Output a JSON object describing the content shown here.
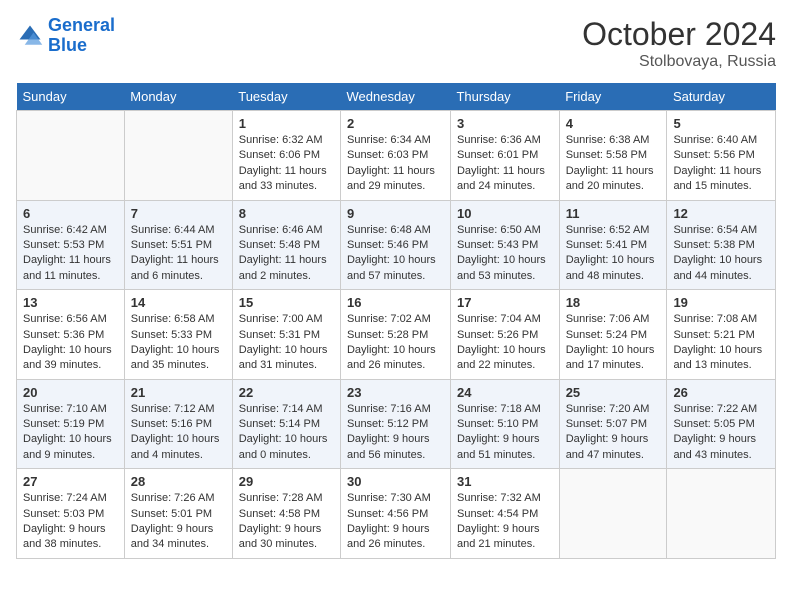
{
  "header": {
    "logo_line1": "General",
    "logo_line2": "Blue",
    "month": "October 2024",
    "location": "Stolbovaya, Russia"
  },
  "days_of_week": [
    "Sunday",
    "Monday",
    "Tuesday",
    "Wednesday",
    "Thursday",
    "Friday",
    "Saturday"
  ],
  "weeks": [
    [
      {
        "day": "",
        "info": ""
      },
      {
        "day": "",
        "info": ""
      },
      {
        "day": "1",
        "info": "Sunrise: 6:32 AM\nSunset: 6:06 PM\nDaylight: 11 hours and 33 minutes."
      },
      {
        "day": "2",
        "info": "Sunrise: 6:34 AM\nSunset: 6:03 PM\nDaylight: 11 hours and 29 minutes."
      },
      {
        "day": "3",
        "info": "Sunrise: 6:36 AM\nSunset: 6:01 PM\nDaylight: 11 hours and 24 minutes."
      },
      {
        "day": "4",
        "info": "Sunrise: 6:38 AM\nSunset: 5:58 PM\nDaylight: 11 hours and 20 minutes."
      },
      {
        "day": "5",
        "info": "Sunrise: 6:40 AM\nSunset: 5:56 PM\nDaylight: 11 hours and 15 minutes."
      }
    ],
    [
      {
        "day": "6",
        "info": "Sunrise: 6:42 AM\nSunset: 5:53 PM\nDaylight: 11 hours and 11 minutes."
      },
      {
        "day": "7",
        "info": "Sunrise: 6:44 AM\nSunset: 5:51 PM\nDaylight: 11 hours and 6 minutes."
      },
      {
        "day": "8",
        "info": "Sunrise: 6:46 AM\nSunset: 5:48 PM\nDaylight: 11 hours and 2 minutes."
      },
      {
        "day": "9",
        "info": "Sunrise: 6:48 AM\nSunset: 5:46 PM\nDaylight: 10 hours and 57 minutes."
      },
      {
        "day": "10",
        "info": "Sunrise: 6:50 AM\nSunset: 5:43 PM\nDaylight: 10 hours and 53 minutes."
      },
      {
        "day": "11",
        "info": "Sunrise: 6:52 AM\nSunset: 5:41 PM\nDaylight: 10 hours and 48 minutes."
      },
      {
        "day": "12",
        "info": "Sunrise: 6:54 AM\nSunset: 5:38 PM\nDaylight: 10 hours and 44 minutes."
      }
    ],
    [
      {
        "day": "13",
        "info": "Sunrise: 6:56 AM\nSunset: 5:36 PM\nDaylight: 10 hours and 39 minutes."
      },
      {
        "day": "14",
        "info": "Sunrise: 6:58 AM\nSunset: 5:33 PM\nDaylight: 10 hours and 35 minutes."
      },
      {
        "day": "15",
        "info": "Sunrise: 7:00 AM\nSunset: 5:31 PM\nDaylight: 10 hours and 31 minutes."
      },
      {
        "day": "16",
        "info": "Sunrise: 7:02 AM\nSunset: 5:28 PM\nDaylight: 10 hours and 26 minutes."
      },
      {
        "day": "17",
        "info": "Sunrise: 7:04 AM\nSunset: 5:26 PM\nDaylight: 10 hours and 22 minutes."
      },
      {
        "day": "18",
        "info": "Sunrise: 7:06 AM\nSunset: 5:24 PM\nDaylight: 10 hours and 17 minutes."
      },
      {
        "day": "19",
        "info": "Sunrise: 7:08 AM\nSunset: 5:21 PM\nDaylight: 10 hours and 13 minutes."
      }
    ],
    [
      {
        "day": "20",
        "info": "Sunrise: 7:10 AM\nSunset: 5:19 PM\nDaylight: 10 hours and 9 minutes."
      },
      {
        "day": "21",
        "info": "Sunrise: 7:12 AM\nSunset: 5:16 PM\nDaylight: 10 hours and 4 minutes."
      },
      {
        "day": "22",
        "info": "Sunrise: 7:14 AM\nSunset: 5:14 PM\nDaylight: 10 hours and 0 minutes."
      },
      {
        "day": "23",
        "info": "Sunrise: 7:16 AM\nSunset: 5:12 PM\nDaylight: 9 hours and 56 minutes."
      },
      {
        "day": "24",
        "info": "Sunrise: 7:18 AM\nSunset: 5:10 PM\nDaylight: 9 hours and 51 minutes."
      },
      {
        "day": "25",
        "info": "Sunrise: 7:20 AM\nSunset: 5:07 PM\nDaylight: 9 hours and 47 minutes."
      },
      {
        "day": "26",
        "info": "Sunrise: 7:22 AM\nSunset: 5:05 PM\nDaylight: 9 hours and 43 minutes."
      }
    ],
    [
      {
        "day": "27",
        "info": "Sunrise: 7:24 AM\nSunset: 5:03 PM\nDaylight: 9 hours and 38 minutes."
      },
      {
        "day": "28",
        "info": "Sunrise: 7:26 AM\nSunset: 5:01 PM\nDaylight: 9 hours and 34 minutes."
      },
      {
        "day": "29",
        "info": "Sunrise: 7:28 AM\nSunset: 4:58 PM\nDaylight: 9 hours and 30 minutes."
      },
      {
        "day": "30",
        "info": "Sunrise: 7:30 AM\nSunset: 4:56 PM\nDaylight: 9 hours and 26 minutes."
      },
      {
        "day": "31",
        "info": "Sunrise: 7:32 AM\nSunset: 4:54 PM\nDaylight: 9 hours and 21 minutes."
      },
      {
        "day": "",
        "info": ""
      },
      {
        "day": "",
        "info": ""
      }
    ]
  ]
}
